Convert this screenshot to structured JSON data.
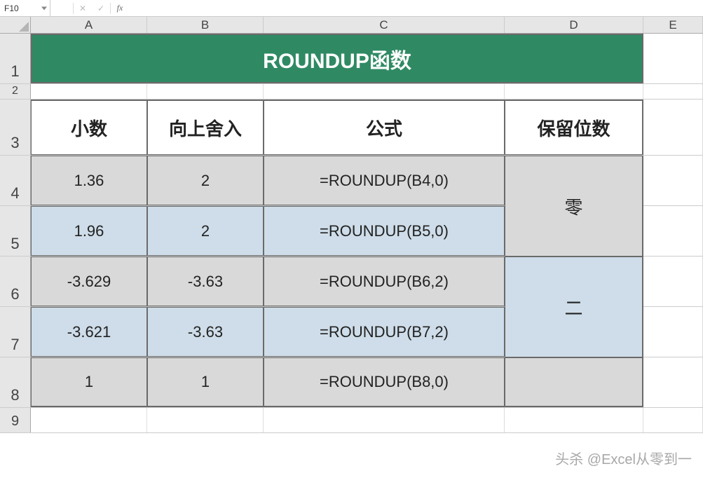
{
  "formula_bar": {
    "name_box": "F10",
    "cancel": "✕",
    "confirm": "✓",
    "fx": "fx",
    "input": ""
  },
  "columns": {
    "a": "A",
    "b": "B",
    "c": "C",
    "d": "D",
    "e": "E"
  },
  "rows": {
    "r1": "1",
    "r2": "2",
    "r3": "3",
    "r4": "4",
    "r5": "5",
    "r6": "6",
    "r7": "7",
    "r8": "8",
    "r9": "9"
  },
  "title": "ROUNDUP函数",
  "headers": {
    "a": "小数",
    "b": "向上舍入",
    "c": "公式",
    "d": "保留位数"
  },
  "data": [
    {
      "a": "1.36",
      "b": "2",
      "c": "=ROUNDUP(B4,0)"
    },
    {
      "a": "1.96",
      "b": "2",
      "c": "=ROUNDUP(B5,0)"
    },
    {
      "a": "-3.629",
      "b": "-3.63",
      "c": "=ROUNDUP(B6,2)"
    },
    {
      "a": "-3.621",
      "b": "-3.63",
      "c": "=ROUNDUP(B7,2)"
    },
    {
      "a": "1",
      "b": "1",
      "c": "=ROUNDUP(B8,0)"
    }
  ],
  "merged_d": {
    "first": "零",
    "second": "二"
  },
  "watermark": "头杀 @Excel从零到一"
}
